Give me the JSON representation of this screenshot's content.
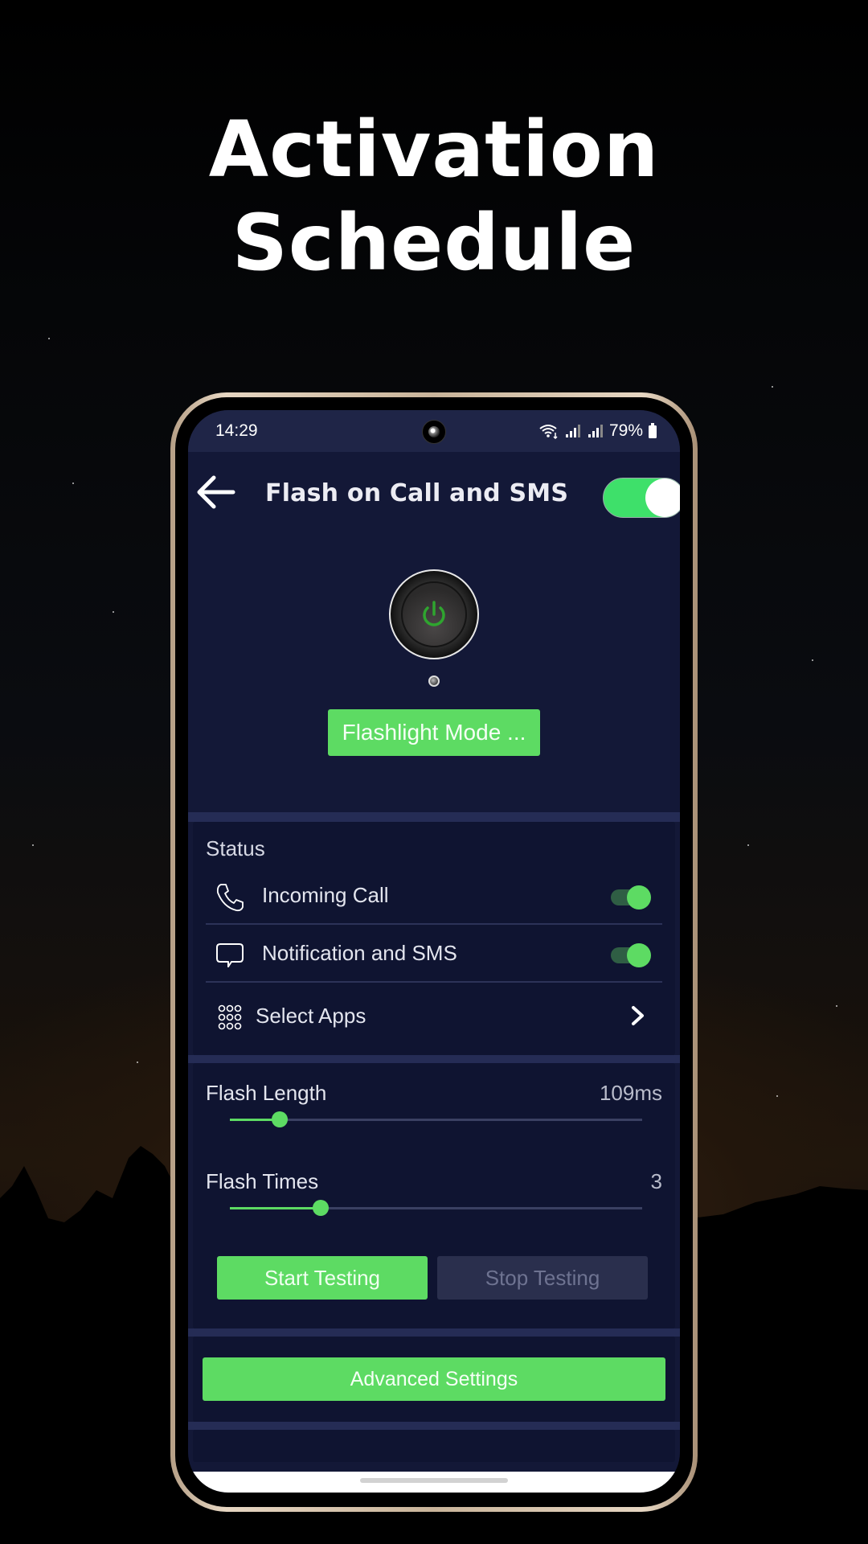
{
  "promo": {
    "headline_line1": "Activation",
    "headline_line2": "Schedule"
  },
  "status_bar": {
    "time": "14:29",
    "battery": "79%",
    "icons": [
      "wifi-icon",
      "signal-icon",
      "signal-icon",
      "battery-icon"
    ]
  },
  "header": {
    "back_icon": "arrow-left-icon",
    "title": "Flash on Call and SMS",
    "master_toggle_on": true
  },
  "power": {
    "icon": "power-icon",
    "mode_button": "Flashlight Mode ..."
  },
  "status_section": {
    "label": "Status",
    "items": [
      {
        "icon": "phone-icon",
        "label": "Incoming Call",
        "enabled": true
      },
      {
        "icon": "message-icon",
        "label": "Notification and SMS",
        "enabled": true
      },
      {
        "icon": "apps-grid-icon",
        "label": "Select Apps",
        "trailing": "chevron-right-icon"
      }
    ]
  },
  "sliders": [
    {
      "label": "Flash Length",
      "value_text": "109ms",
      "fraction": 0.12
    },
    {
      "label": "Flash Times",
      "value_text": "3",
      "fraction": 0.22
    }
  ],
  "testing": {
    "start_label": "Start Testing",
    "stop_label": "Stop Testing"
  },
  "advanced": {
    "label": "Advanced Settings"
  },
  "colors": {
    "accent_green": "#5ddb63",
    "screen_bg": "#131837",
    "card_bg": "#0f1431"
  }
}
